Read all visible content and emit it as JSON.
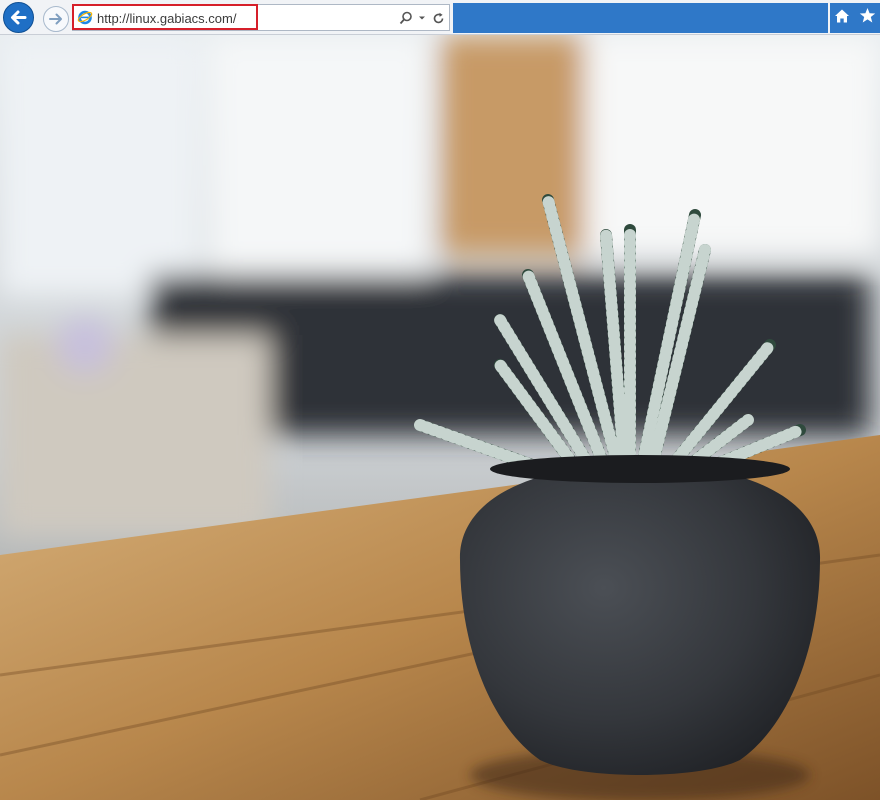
{
  "browser": {
    "address": {
      "url": "http://linux.gabiacs.com/"
    },
    "icons": {
      "back": "back-arrow-icon",
      "forward": "forward-arrow-icon",
      "site": "internet-explorer-icon",
      "search": "search-icon",
      "dropdown": "chevron-down-icon",
      "refresh": "refresh-icon",
      "home": "home-icon",
      "favorites": "star-icon"
    },
    "colors": {
      "tab_bar": "#2f78c8",
      "highlight": "#d61f2a"
    }
  },
  "page": {
    "content": "photo of a striped succulent plant in a dark round pot on a wooden table"
  }
}
